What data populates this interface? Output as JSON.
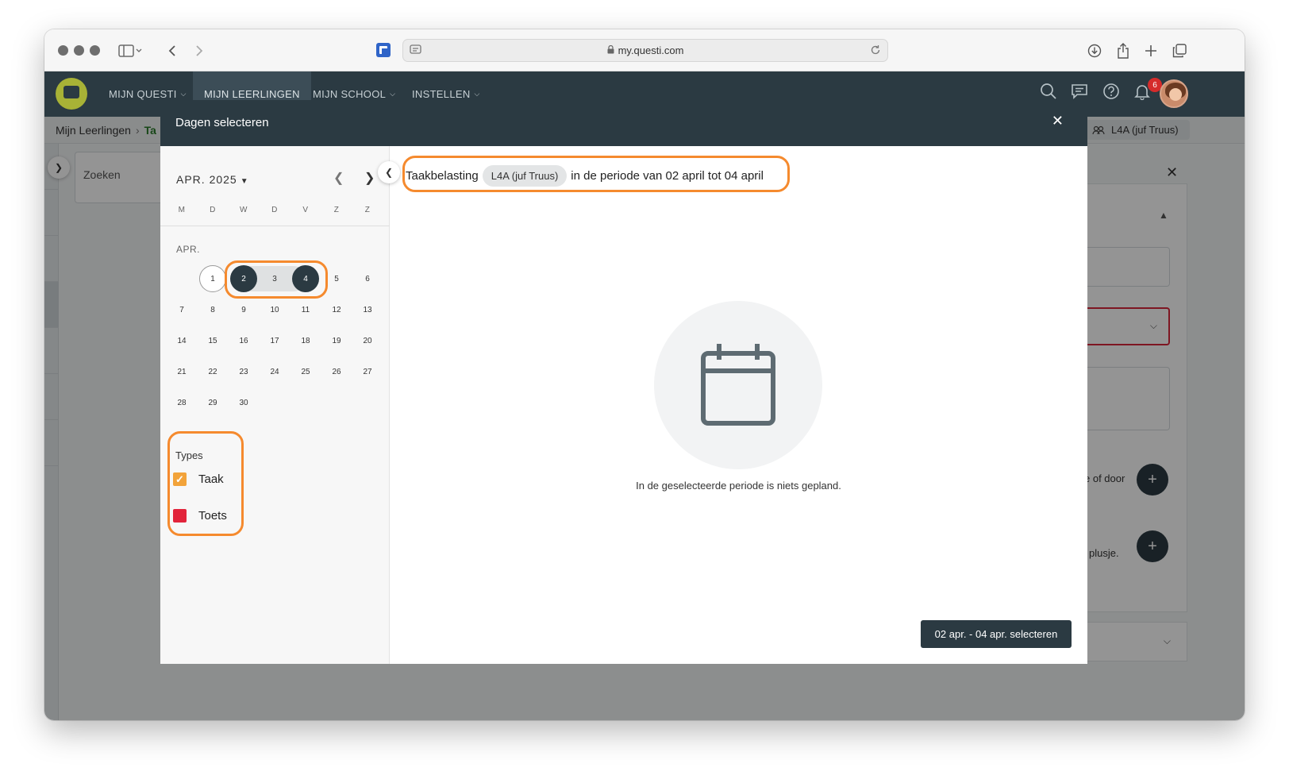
{
  "browser": {
    "url": "my.questi.com"
  },
  "nav": {
    "items": [
      {
        "label": "MIJN QUESTI"
      },
      {
        "label": "MIJN LEERLINGEN"
      },
      {
        "label": "MIJN SCHOOL"
      },
      {
        "label": "INSTELLEN"
      }
    ],
    "notification_count": "6"
  },
  "page": {
    "breadcrumb_root": "Mijn Leerlingen",
    "breadcrumb_next": "Ta",
    "class_chip": "L4A (juf Truus)",
    "search_placeholder": "Zoeken",
    "right_text_1": "e of door",
    "right_text_2": "plusje."
  },
  "modal": {
    "title": "Dagen selecteren",
    "calendar": {
      "month_year": "APR. 2025",
      "weekdays": [
        "M",
        "D",
        "W",
        "D",
        "V",
        "Z",
        "Z"
      ],
      "month_label": "APR.",
      "weeks": [
        [
          "",
          "1",
          "2",
          "3",
          "4",
          "5",
          "6"
        ],
        [
          "7",
          "8",
          "9",
          "10",
          "11",
          "12",
          "13"
        ],
        [
          "14",
          "15",
          "16",
          "17",
          "18",
          "19",
          "20"
        ],
        [
          "21",
          "22",
          "23",
          "24",
          "25",
          "26",
          "27"
        ],
        [
          "28",
          "29",
          "30",
          "",
          "",
          "",
          ""
        ]
      ],
      "today": "1",
      "selected_start": "2",
      "selected_end": "4"
    },
    "types": {
      "title": "Types",
      "items": [
        {
          "label": "Taak",
          "color": "#f2a33a",
          "checked": true
        },
        {
          "label": "Toets",
          "color": "#e2243b",
          "checked": false
        }
      ]
    },
    "workload": {
      "prefix": "Taakbelasting",
      "class": "L4A (juf Truus)",
      "suffix": "in de periode van 02 april tot 04 april"
    },
    "empty_text": "In de geselecteerde periode is niets gepland.",
    "select_button": "02 apr. - 04 apr. selecteren"
  }
}
